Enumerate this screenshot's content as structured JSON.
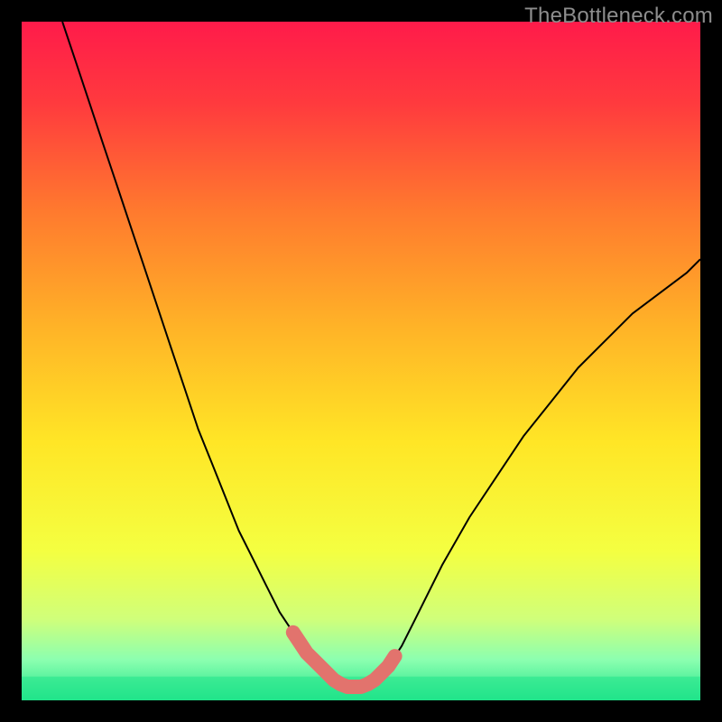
{
  "watermark": "TheBottleneck.com",
  "chart_data": {
    "type": "line",
    "title": "",
    "xlabel": "",
    "ylabel": "",
    "xlim": [
      0,
      100
    ],
    "ylim": [
      0,
      100
    ],
    "series": [
      {
        "name": "bottleneck-curve",
        "x": [
          6,
          8,
          10,
          12,
          14,
          16,
          18,
          20,
          22,
          24,
          26,
          28,
          30,
          32,
          34,
          36,
          38,
          40,
          42,
          44,
          46,
          48,
          50,
          52,
          54,
          56,
          58,
          60,
          62,
          66,
          70,
          74,
          78,
          82,
          86,
          90,
          94,
          98,
          100
        ],
        "y": [
          100,
          94,
          88,
          82,
          76,
          70,
          64,
          58,
          52,
          46,
          40,
          35,
          30,
          25,
          21,
          17,
          13,
          10,
          7,
          5,
          3,
          2,
          2,
          3,
          5,
          8,
          12,
          16,
          20,
          27,
          33,
          39,
          44,
          49,
          53,
          57,
          60,
          63,
          65
        ]
      },
      {
        "name": "optimal-zone-highlight",
        "x": [
          40,
          41,
          42,
          43,
          44,
          45,
          46,
          47,
          48,
          49,
          50,
          51,
          52,
          53,
          54,
          55
        ],
        "y": [
          10,
          8.5,
          7,
          6,
          5,
          4,
          3,
          2.4,
          2,
          2,
          2,
          2.4,
          3,
          4,
          5,
          6.5
        ]
      }
    ],
    "gradient_stops": [
      {
        "offset": 0.0,
        "color": "#ff1b4a"
      },
      {
        "offset": 0.12,
        "color": "#ff3a3e"
      },
      {
        "offset": 0.28,
        "color": "#ff7a2e"
      },
      {
        "offset": 0.45,
        "color": "#ffb327"
      },
      {
        "offset": 0.62,
        "color": "#ffe626"
      },
      {
        "offset": 0.78,
        "color": "#f4ff41"
      },
      {
        "offset": 0.88,
        "color": "#d0ff7a"
      },
      {
        "offset": 0.94,
        "color": "#8cffb0"
      },
      {
        "offset": 1.0,
        "color": "#20e48a"
      }
    ],
    "green_band": {
      "y_from": 0,
      "y_to": 3.5
    },
    "highlight_color": "#e2736d",
    "curve_color": "#000000"
  }
}
